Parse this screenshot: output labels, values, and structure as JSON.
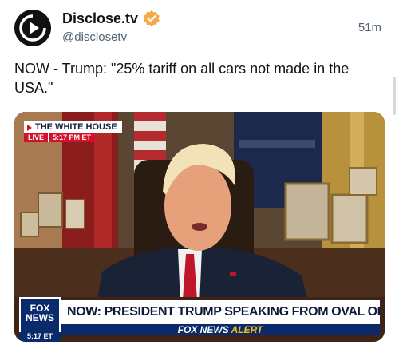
{
  "post": {
    "display_name": "Disclose.tv",
    "handle": "@disclosetv",
    "time": "51m",
    "verified": true,
    "text": "NOW - Trump: \"25% tariff on all cars not made in the USA.\""
  },
  "media": {
    "location_tag": "THE WHITE HOUSE",
    "live_label": "LIVE",
    "live_time": "5:17 PM ET",
    "network_logo": "FOX NEWS",
    "logo_clock": "5:17 ET",
    "headline": "NOW: PRESIDENT TRUMP SPEAKING FROM OVAL OFFICE",
    "alert_brand": "FOX NEWS",
    "alert_word": "ALERT"
  },
  "colors": {
    "accent_verified": "#f6a94b",
    "handle_gray": "#536471",
    "fox_blue": "#0b2a6b",
    "fox_red": "#d3112b",
    "alert_yellow": "#f3c20f"
  },
  "icons": {
    "avatar": "play-arrow-in-circle",
    "verified": "verified-badge-icon"
  }
}
